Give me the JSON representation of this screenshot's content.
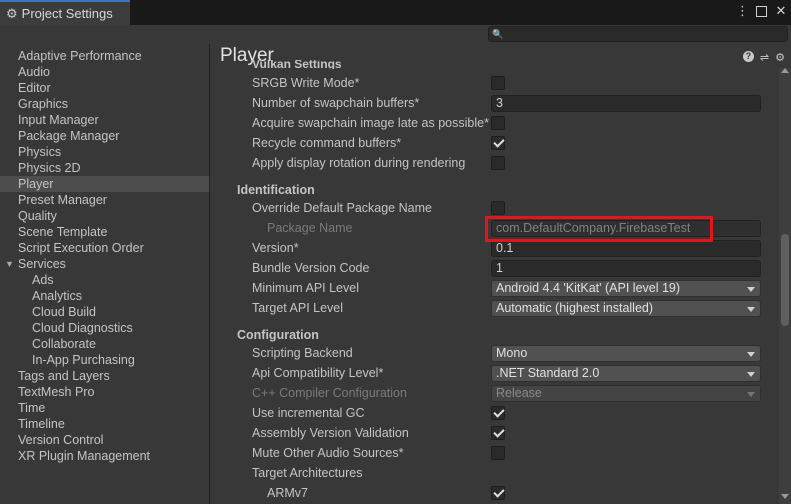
{
  "window": {
    "tab_title": "Project Settings",
    "tab_icon": "gear-icon",
    "menu_icon": "⋮",
    "maximize_icon": "maximize-icon",
    "close_icon": "✕"
  },
  "search": {
    "placeholder": "",
    "value": "",
    "icon": "🔍"
  },
  "sidebar": {
    "items": [
      {
        "label": "Adaptive Performance"
      },
      {
        "label": "Audio"
      },
      {
        "label": "Editor"
      },
      {
        "label": "Graphics"
      },
      {
        "label": "Input Manager"
      },
      {
        "label": "Package Manager"
      },
      {
        "label": "Physics"
      },
      {
        "label": "Physics 2D"
      },
      {
        "label": "Player",
        "selected": true
      },
      {
        "label": "Preset Manager"
      },
      {
        "label": "Quality"
      },
      {
        "label": "Scene Template"
      },
      {
        "label": "Script Execution Order"
      },
      {
        "label": "Services",
        "expanded": true
      },
      {
        "label": "Ads"
      },
      {
        "label": "Analytics"
      },
      {
        "label": "Cloud Build"
      },
      {
        "label": "Cloud Diagnostics"
      },
      {
        "label": "Collaborate"
      },
      {
        "label": "In-App Purchasing"
      },
      {
        "label": "Tags and Layers"
      },
      {
        "label": "TextMesh Pro"
      },
      {
        "label": "Time"
      },
      {
        "label": "Timeline"
      },
      {
        "label": "Version Control"
      },
      {
        "label": "XR Plugin Management"
      }
    ]
  },
  "main": {
    "title": "Player",
    "header_icons": [
      "help-icon",
      "sliders-icon",
      "gear-icon"
    ],
    "partial_section": "Vulkan Settings",
    "vulkan": {
      "srgb_write_mode": {
        "label": "SRGB Write Mode*",
        "checked": false
      },
      "swapchain_buffers": {
        "label": "Number of swapchain buffers*",
        "value": "3"
      },
      "acquire_late": {
        "label": "Acquire swapchain image late as possible*",
        "checked": false
      },
      "recycle_buffers": {
        "label": "Recycle command buffers*",
        "checked": true
      },
      "display_rotation": {
        "label": "Apply display rotation during rendering",
        "checked": false
      }
    },
    "identification": {
      "heading": "Identification",
      "override_name": {
        "label": "Override Default Package Name",
        "checked": false
      },
      "package_name": {
        "label": "Package Name",
        "value": "com.DefaultCompany.FirebaseTest"
      },
      "version": {
        "label": "Version*",
        "value": "0.1"
      },
      "bundle_code": {
        "label": "Bundle Version Code",
        "value": "1"
      },
      "min_api": {
        "label": "Minimum API Level",
        "value": "Android 4.4 'KitKat' (API level 19)"
      },
      "target_api": {
        "label": "Target API Level",
        "value": "Automatic (highest installed)"
      }
    },
    "configuration": {
      "heading": "Configuration",
      "scripting_backend": {
        "label": "Scripting Backend",
        "value": "Mono"
      },
      "api_compat": {
        "label": "Api Compatibility Level*",
        "value": ".NET Standard 2.0"
      },
      "cpp_config": {
        "label": "C++ Compiler Configuration",
        "value": "Release"
      },
      "incremental_gc": {
        "label": "Use incremental GC",
        "checked": true
      },
      "assembly_validation": {
        "label": "Assembly Version Validation",
        "checked": true
      },
      "mute_audio": {
        "label": "Mute Other Audio Sources*",
        "checked": false
      },
      "target_arch": {
        "label": "Target Architectures"
      },
      "armv7": {
        "label": "ARMv7",
        "checked": true
      }
    }
  },
  "colors": {
    "accent": "#3a79bb",
    "highlight_box": "#e3151a"
  }
}
